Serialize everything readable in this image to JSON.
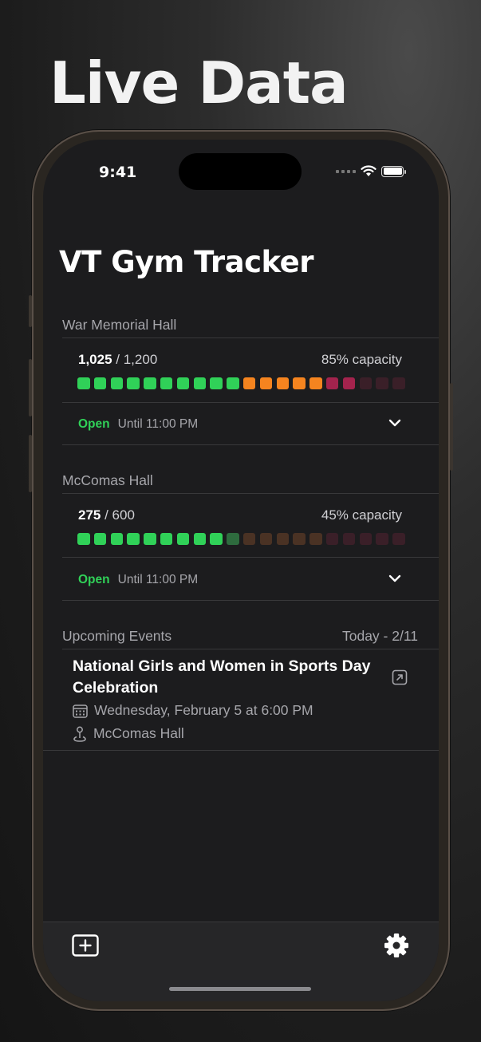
{
  "hero": {
    "title": "Live Data"
  },
  "status_bar": {
    "time": "9:41"
  },
  "app": {
    "title": "VT Gym Tracker"
  },
  "gyms": [
    {
      "name": "War Memorial Hall",
      "count": "1,025",
      "capacity_total": "/ 1,200",
      "capacity_label": "85% capacity",
      "status": "Open",
      "hours": "Until 11:00 PM",
      "occupancy_fraction": 0.85,
      "bar": [
        "green",
        "green",
        "green",
        "green",
        "green",
        "green",
        "green",
        "green",
        "green",
        "green",
        "orange",
        "orange",
        "orange",
        "orange",
        "orange",
        "red",
        "red",
        "dimred",
        "dimred",
        "dimred"
      ]
    },
    {
      "name": "McComas Hall",
      "count": "275",
      "capacity_total": "/ 600",
      "capacity_label": "45% capacity",
      "status": "Open",
      "hours": "Until 11:00 PM",
      "occupancy_fraction": 0.45,
      "bar": [
        "green",
        "green",
        "green",
        "green",
        "green",
        "green",
        "green",
        "green",
        "green",
        "dimgreen",
        "dimorange",
        "dimorange",
        "dimorange",
        "dimorange",
        "dimorange",
        "dimred",
        "dimred",
        "dimred",
        "dimred",
        "dimred"
      ]
    }
  ],
  "events": {
    "header": "Upcoming Events",
    "date_range": "Today - 2/11",
    "items": [
      {
        "title": "National Girls and Women in Sports Day Celebration",
        "datetime": "Wednesday, February 5 at 6:00 PM",
        "location": "McComas Hall"
      }
    ]
  },
  "icons": {
    "status": [
      "cellular-dots-icon",
      "wifi-icon",
      "battery-icon"
    ],
    "gym_row": "chevron-down-icon",
    "event": [
      "external-link-icon",
      "calendar-icon",
      "location-pin-icon"
    ],
    "tab_bar": [
      "add-widget-icon",
      "gear-icon"
    ]
  },
  "colors": {
    "background": "#1c1c1e",
    "open": "#30d158",
    "green": "#30d158",
    "orange": "#f5841f",
    "red": "#a3234d",
    "dimgreen": "#2e6b3e",
    "dimorange": "#4a3224",
    "dimred": "#3a1f28"
  }
}
